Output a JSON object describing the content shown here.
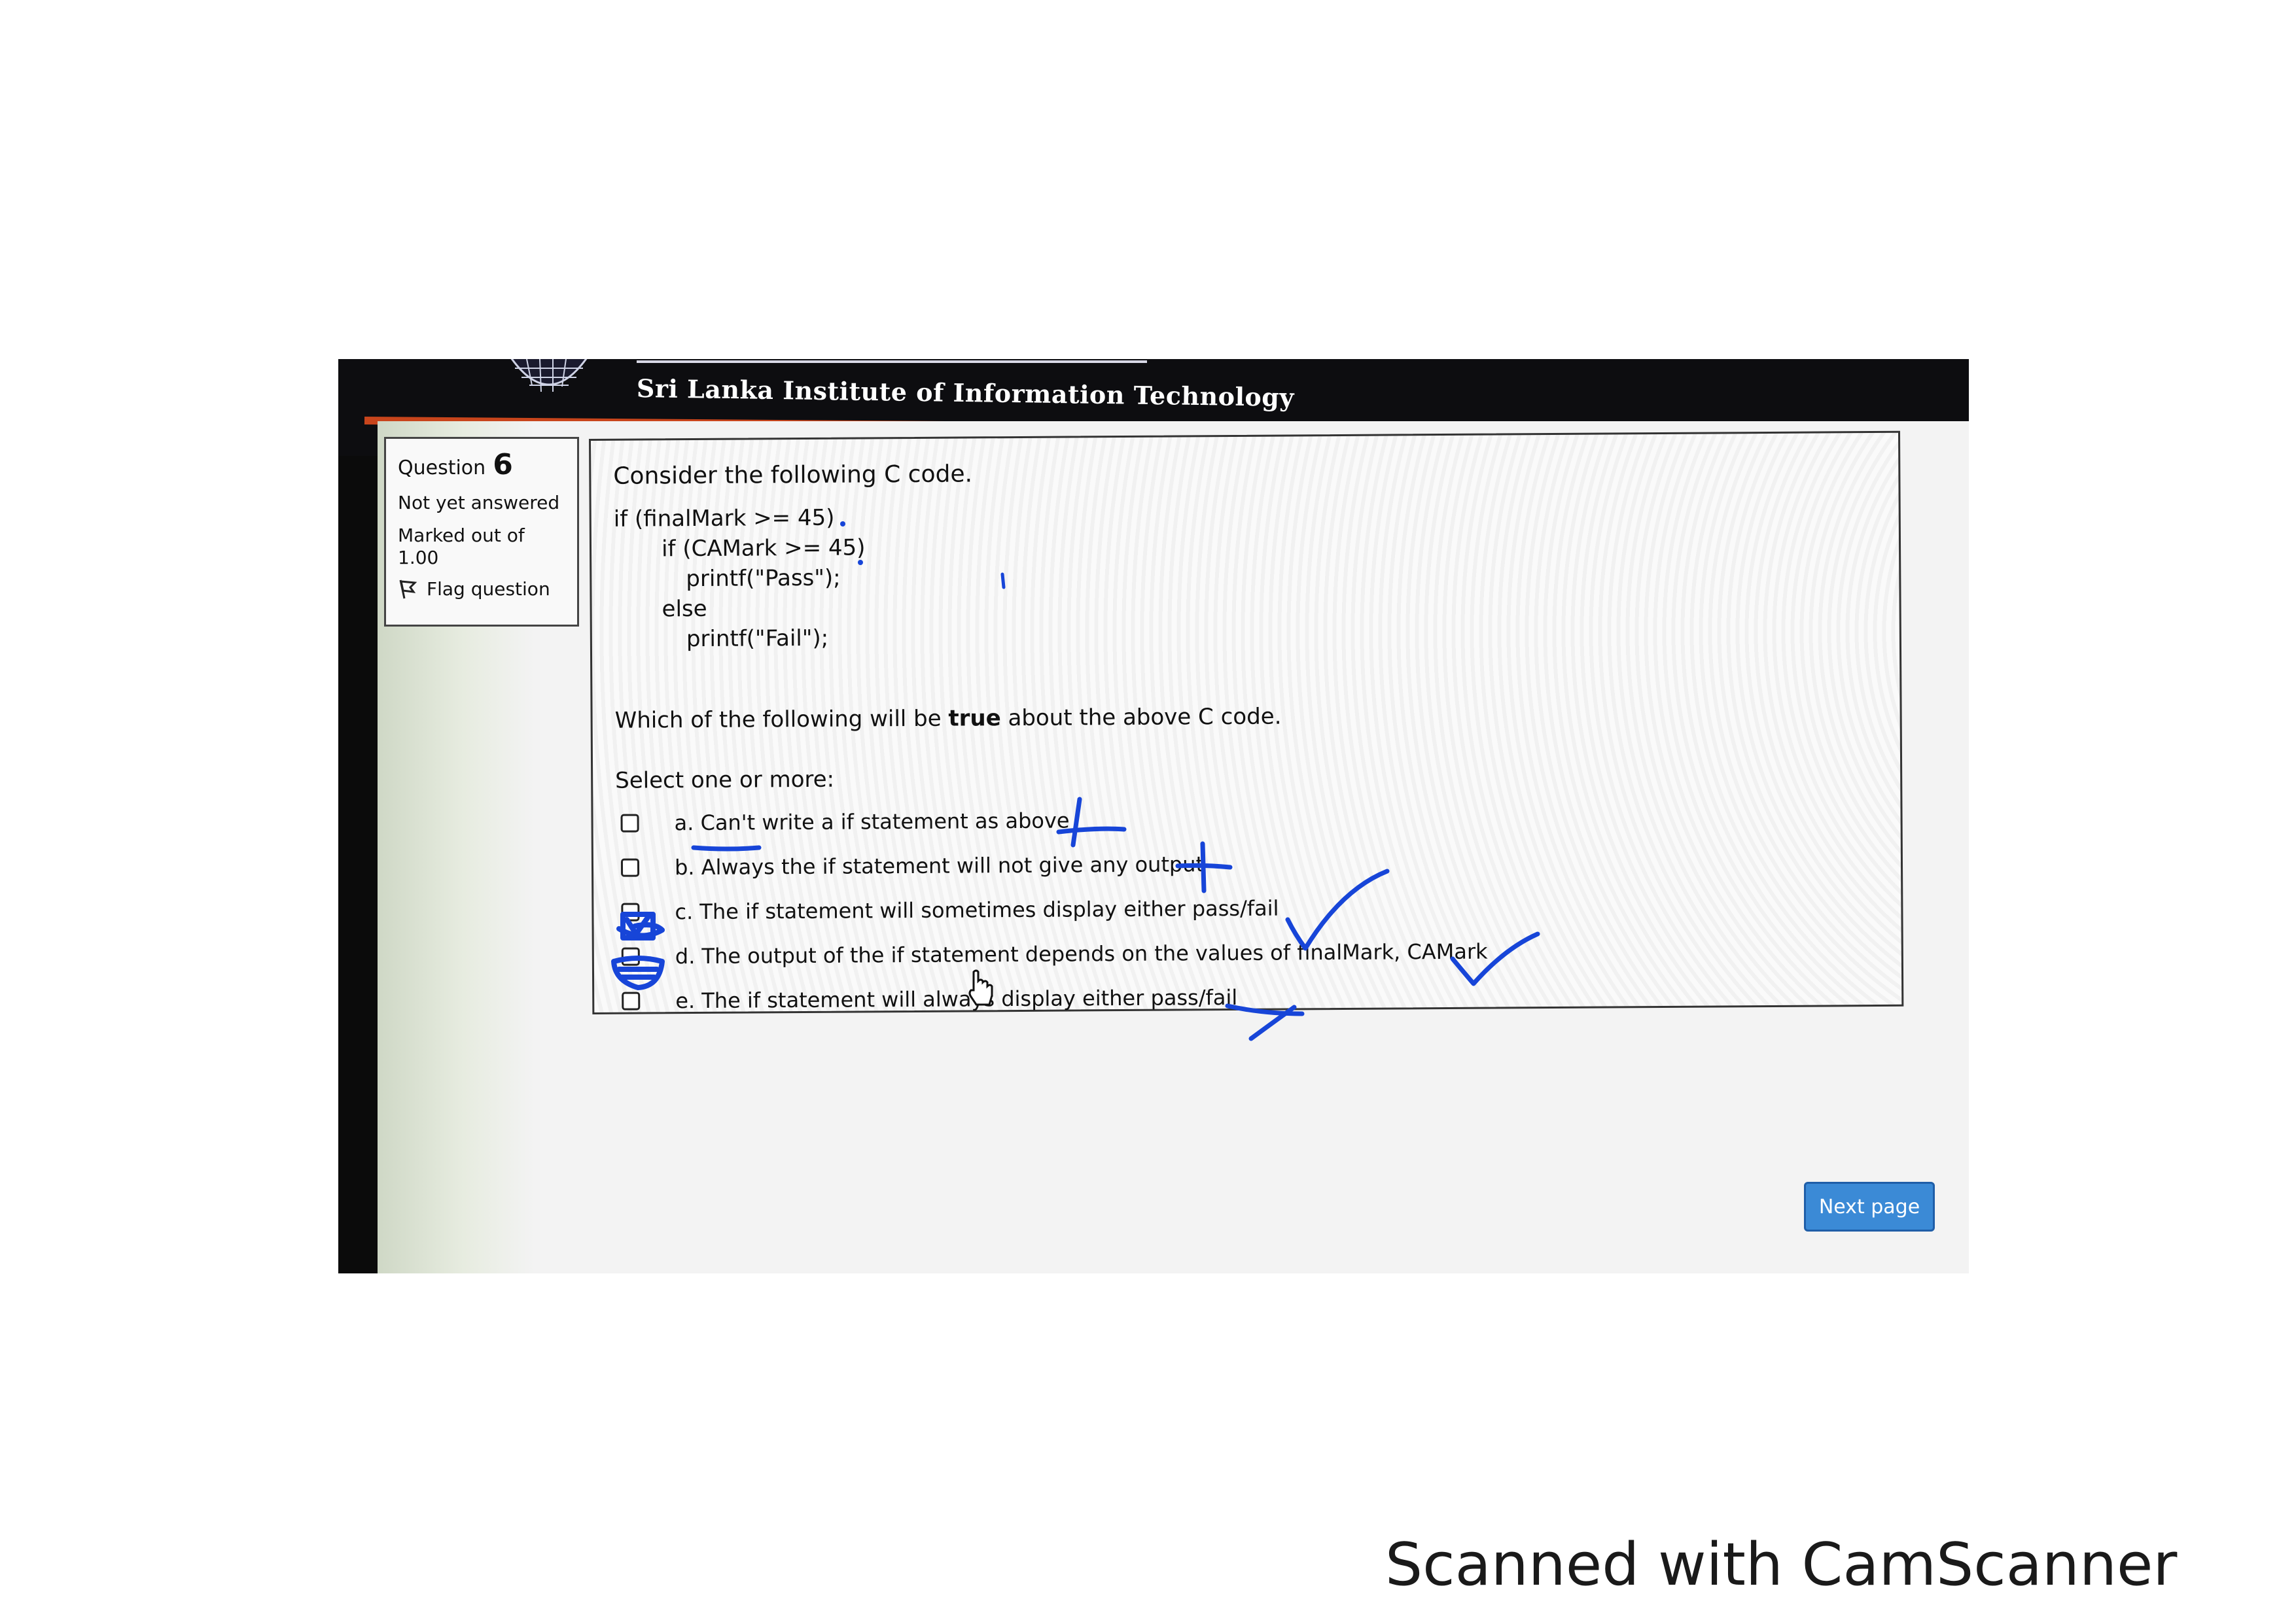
{
  "site": {
    "title": "Sri Lanka Institute of Information Technology"
  },
  "question_info": {
    "question_label": "Question",
    "question_number": "6",
    "status": "Not yet answered",
    "marked_line1": "Marked out of",
    "marked_line2": "1.00",
    "flag_label": "Flag question"
  },
  "question": {
    "prompt": "Consider the following C code.",
    "code_lines": [
      "if (finalMark >= 45)",
      "if (CAMark >= 45)",
      "printf(\"Pass\");",
      "else",
      "printf(\"Fail\");"
    ],
    "text_before": "Which of the following will be",
    "text_bold": "true",
    "text_after": "about the above C code.",
    "select_label": "Select one or more:",
    "options": [
      {
        "label": "a. Can't write a if statement as above",
        "checked": false
      },
      {
        "label": "b. Always the if statement will not give any output",
        "checked": false
      },
      {
        "label": "c. The if statement will sometimes display either pass/fail",
        "checked": true
      },
      {
        "label": "d. The output of the if statement depends on the values of finalMark, CAMark",
        "checked": true
      },
      {
        "label": "e. The if statement will always display either pass/fail",
        "checked": false
      }
    ]
  },
  "navigation": {
    "next_label": "Next page"
  },
  "watermark": {
    "text": "Scanned with CamScanner"
  },
  "colors": {
    "ink": "#1745d8",
    "button": "#3b8ad6",
    "header_accent": "#c8451c"
  }
}
